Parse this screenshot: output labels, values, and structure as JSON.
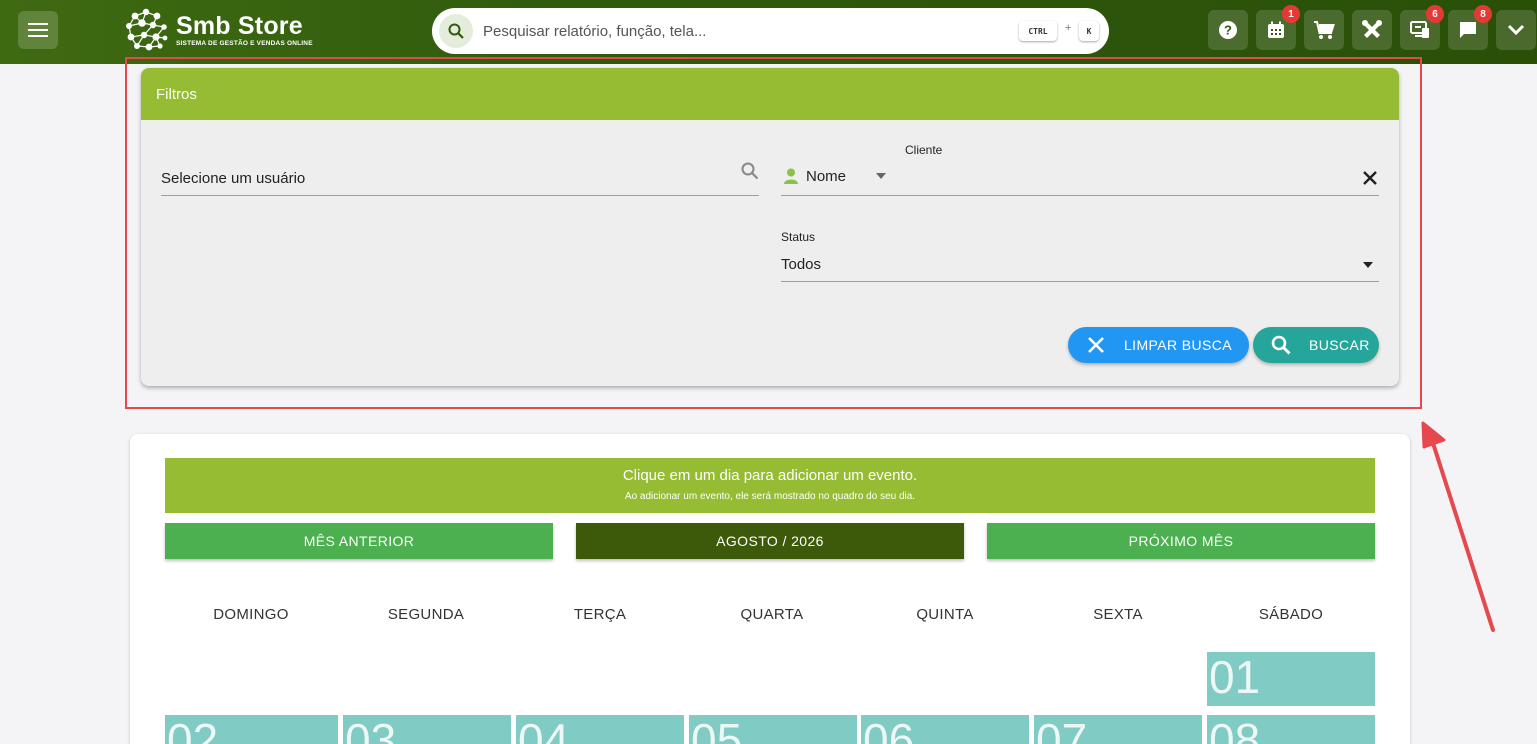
{
  "topbar": {
    "logo_title": "Smb Store",
    "logo_subtitle": "SISTEMA DE GESTÃO E VENDAS ONLINE",
    "search_placeholder": "Pesquisar relatório, função, tela...",
    "shortcut_key1": "CTRL",
    "shortcut_plus": "+",
    "shortcut_key2": "K",
    "badges": {
      "calendar": "1",
      "remote": "6",
      "chat": "8"
    }
  },
  "filters": {
    "title": "Filtros",
    "user_placeholder": "Selecione um usuário",
    "client_label": "Cliente",
    "client_type": "Nome",
    "status_label": "Status",
    "status_value": "Todos",
    "clear_label": "LIMPAR BUSCA",
    "search_label": "BUSCAR"
  },
  "calendar": {
    "banner_title": "Clique em um dia para adicionar um evento.",
    "banner_sub": "Ao adicionar um evento, ele será mostrado no quadro do seu dia.",
    "prev_label": "MÊS ANTERIOR",
    "current_label": "AGOSTO / 2026",
    "next_label": "PRÓXIMO MÊS",
    "weekdays": [
      "DOMINGO",
      "SEGUNDA",
      "TERÇA",
      "QUARTA",
      "QUINTA",
      "SEXTA",
      "SÁBADO"
    ],
    "days": [
      "01",
      "02",
      "03",
      "04",
      "05",
      "06",
      "07",
      "08"
    ]
  },
  "colors": {
    "topbar": "#2f5a0c",
    "accent_green": "#95bc33",
    "nav_green": "#4caf50",
    "nav_dark": "#3d5a0a",
    "day_teal": "#80cbc4",
    "clear_blue": "#2196f3",
    "search_teal": "#26a69a",
    "annotation_red": "#e5484d"
  }
}
